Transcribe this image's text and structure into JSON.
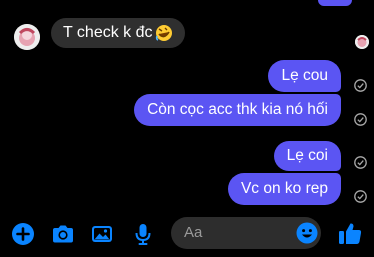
{
  "thread": {
    "incoming": {
      "text": "T check k đc",
      "emoji": "rofl-emoji"
    },
    "outgoing": [
      {
        "text": "Lẹ cou"
      },
      {
        "text": "Còn cọc acc thk kia nó hối"
      },
      {
        "text": "Lẹ coi"
      },
      {
        "text": "Vc on ko rep"
      }
    ]
  },
  "composer": {
    "placeholder": "Aa",
    "tools": [
      "plus-icon",
      "camera-icon",
      "image-icon",
      "microphone-icon"
    ],
    "send_like": "thumbs-up-icon"
  },
  "colors": {
    "accent": "#0a84ff",
    "outgoing_bubble": "#5b55f3",
    "incoming_bubble": "#2f2f2f",
    "background": "#000000"
  }
}
